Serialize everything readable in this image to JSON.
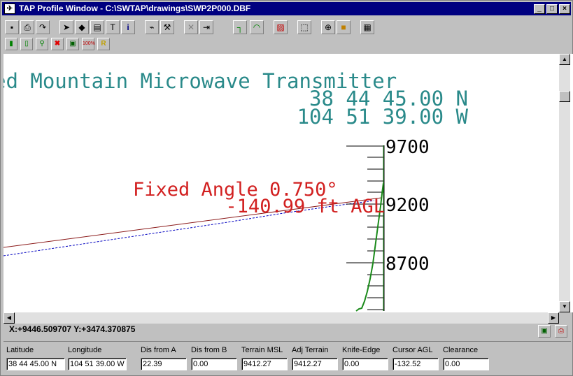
{
  "window": {
    "title": "TAP Profile Window - C:\\SWTAP\\drawings\\SWP2P000.DBF"
  },
  "toolbar1_icons": [
    "save-icon",
    "print-icon",
    "redo-icon",
    "pointer-icon",
    "fill-icon",
    "page-icon",
    "text-icon",
    "info-icon",
    "measure-icon",
    "wrench-icon",
    "delete-icon",
    "export-icon",
    "bracket-icon",
    "fresnel-icon",
    "hatch-icon",
    "zoom-box-icon",
    "crosshair-icon",
    "color-icon",
    "grid-icon"
  ],
  "toolbar2_icons": [
    "site-a-icon",
    "site-b-icon",
    "search-icon",
    "cross-icon",
    "map-icon",
    "scale-100-icon",
    "reflect-icon"
  ],
  "toolbar2_labels": {
    "scale": "100%",
    "reflect": "R"
  },
  "profile": {
    "site_name": "ed Mountain Microwave Transmitter",
    "latitude_text": "38 44 45.00 N",
    "longitude_text": "104 51 39.00 W",
    "fixed_angle_text": "Fixed Angle 0.750°",
    "agl_text": "-140.99 ft AGL",
    "elevation_labels": [
      "9700",
      "9200",
      "8700"
    ],
    "colors": {
      "site_text": "#2a8a8a",
      "angle_text": "#d22020",
      "path_line": "#8b1a1a",
      "fresnel_line": "#0000c0",
      "terrain": "#1a8a1a"
    }
  },
  "status": {
    "coordinates": "X:+9446.509707 Y:+3474.370875",
    "fields": [
      {
        "label": "Latitude",
        "value": "38 44 45.00 N"
      },
      {
        "label": "Longitude",
        "value": "104 51 39.00 W"
      },
      {
        "label": "Dis from A",
        "value": "22.39"
      },
      {
        "label": "Dis from B",
        "value": "0.00"
      },
      {
        "label": "Terrain MSL",
        "value": "9412.27"
      },
      {
        "label": "Adj Terrain",
        "value": "9412.27"
      },
      {
        "label": "Knife-Edge",
        "value": "0.00"
      },
      {
        "label": "Cursor AGL",
        "value": "-132.52"
      },
      {
        "label": "Clearance",
        "value": "0.00"
      }
    ]
  }
}
